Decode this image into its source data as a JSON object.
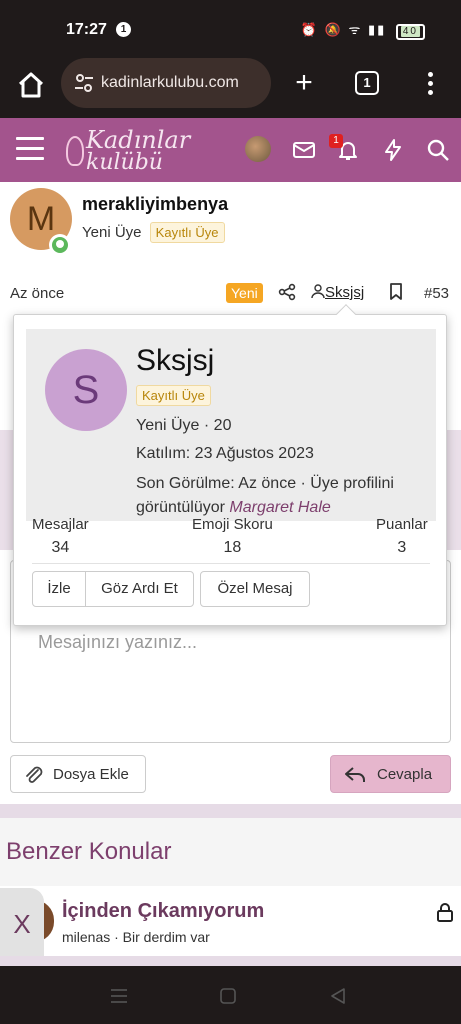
{
  "status": {
    "time": "17:27",
    "notif_count": "1",
    "battery": "40"
  },
  "browser": {
    "url": "kadinlarkulubu.com",
    "tab_count": "1"
  },
  "site": {
    "logo_line1": "Kadınlar",
    "logo_line2": "kulübü",
    "notification_badge": "1"
  },
  "post": {
    "author": "merakliyimbenya",
    "author_initial": "M",
    "role": "Yeni Üye",
    "tag": "Kayıtlı Üye",
    "time": "Az önce",
    "new_label": "Yeni",
    "mention": "Sksjsj",
    "post_number": "#53"
  },
  "popup": {
    "initial": "S",
    "name": "Sksjsj",
    "tag": "Kayıtlı Üye",
    "role_line": "Yeni Üye · 20",
    "joined": "Katılım: 23 Ağustos 2023",
    "last_seen_text": "Son Görülme: Az önce · Üye profilini görüntülüyor",
    "last_seen_link": "Margaret Hale",
    "stats": [
      {
        "label": "Mesajlar",
        "value": "34"
      },
      {
        "label": "Emoji Skoru",
        "value": "18"
      },
      {
        "label": "Puanlar",
        "value": "3"
      }
    ],
    "buttons": {
      "follow": "İzle",
      "ignore": "Göz Ardı Et",
      "message": "Özel Mesaj"
    }
  },
  "reply": {
    "placeholder": "Mesajınızı yazınız...",
    "attach": "Dosya Ekle",
    "submit": "Cevapla"
  },
  "similar": {
    "heading": "Benzer Konular",
    "thread_title": "İçinden Çıkamıyorum",
    "thread_meta": "milenas · Bir derdim var"
  },
  "ad_close": "X"
}
